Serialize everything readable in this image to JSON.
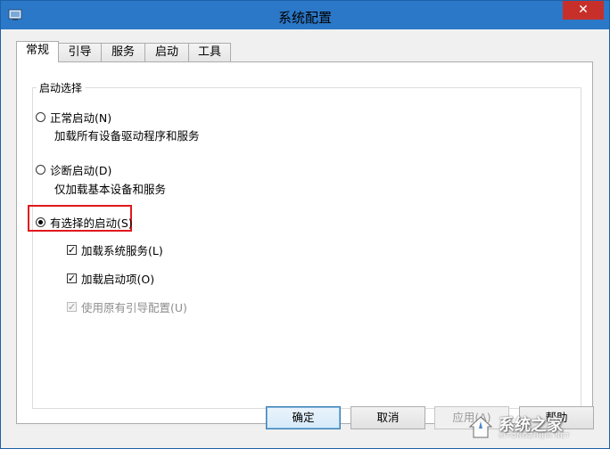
{
  "window": {
    "title": "系统配置",
    "close_glyph": "✕"
  },
  "tabs": [
    {
      "label": "常规",
      "active": true
    },
    {
      "label": "引导",
      "active": false
    },
    {
      "label": "服务",
      "active": false
    },
    {
      "label": "启动",
      "active": false
    },
    {
      "label": "工具",
      "active": false
    }
  ],
  "startup_group": {
    "legend": "启动选择",
    "normal": {
      "label": "正常启动(N)",
      "desc": "加载所有设备驱动程序和服务",
      "checked": false
    },
    "diagnostic": {
      "label": "诊断启动(D)",
      "desc": "仅加载基本设备和服务",
      "checked": false
    },
    "selective": {
      "label": "有选择的启动(S)",
      "checked": true,
      "options": [
        {
          "label": "加载系统服务(L)",
          "checked": true,
          "disabled": false
        },
        {
          "label": "加载启动项(O)",
          "checked": true,
          "disabled": false
        },
        {
          "label": "使用原有引导配置(U)",
          "checked": true,
          "disabled": true
        }
      ]
    }
  },
  "buttons": {
    "ok": "确定",
    "cancel": "取消",
    "apply": "应用(A)",
    "help": "帮助"
  },
  "watermark": {
    "text": "系统之家",
    "sub": "XITONGZHIJIA.NET"
  },
  "colors": {
    "highlight_border": "#e0181e",
    "close_button": "#c7302a",
    "title_bar": "#2b78c8"
  }
}
